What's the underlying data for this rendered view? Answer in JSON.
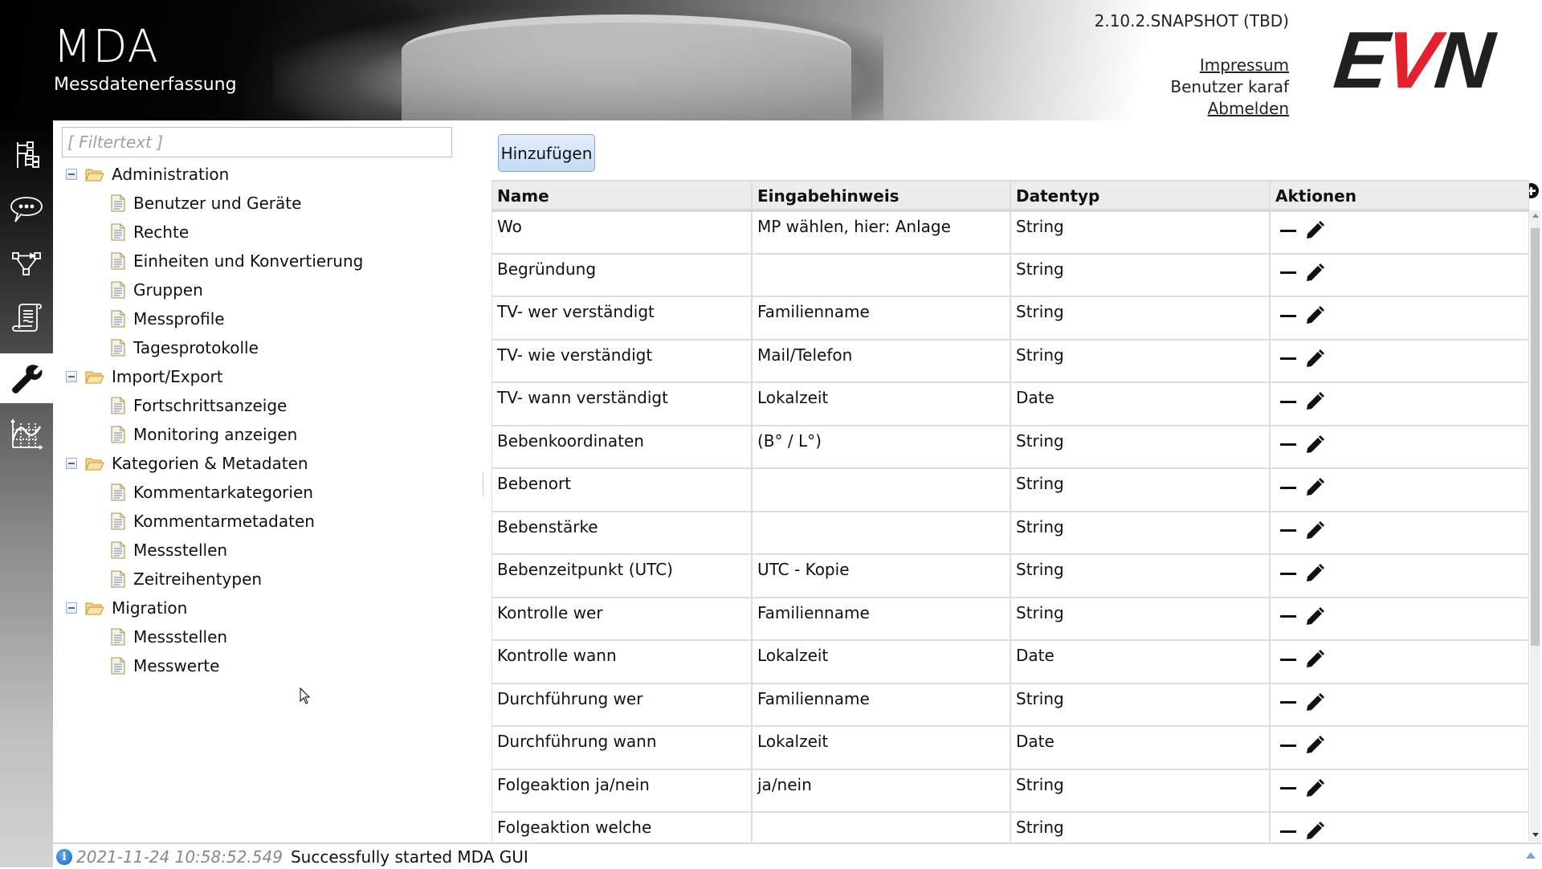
{
  "header": {
    "app_title": "MDA",
    "app_subtitle": "Messdatenerfassung",
    "version": "2.10.2.SNAPSHOT (TBD)",
    "impressum_link": "Impressum",
    "user_label": "Benutzer karaf",
    "logout_link": "Abmelden",
    "logo": {
      "e": "E",
      "v": "V",
      "n": "N"
    },
    "logo_colors": {
      "dark": "#231f20",
      "red": "#e3212e"
    }
  },
  "sidebar": {
    "items": [
      {
        "icon": "hierarchy-tree-icon",
        "active": false
      },
      {
        "icon": "speech-bubble-icon",
        "active": false
      },
      {
        "icon": "workflow-diagram-icon",
        "active": false
      },
      {
        "icon": "scroll-document-icon",
        "active": false
      },
      {
        "icon": "wrench-icon",
        "active": true
      },
      {
        "icon": "line-chart-icon",
        "active": false
      }
    ]
  },
  "tree": {
    "filter_placeholder": "[ Filtertext ]",
    "filter_value": "",
    "nodes": [
      {
        "label": "Administration",
        "type": "folder",
        "expanded": true,
        "children": [
          "Benutzer und Geräte",
          "Rechte",
          "Einheiten und Konvertierung",
          "Gruppen",
          "Messprofile",
          "Tagesprotokolle"
        ]
      },
      {
        "label": "Import/Export",
        "type": "folder",
        "expanded": true,
        "children": [
          "Fortschrittsanzeige",
          "Monitoring anzeigen"
        ]
      },
      {
        "label": "Kategorien & Metadaten",
        "type": "folder",
        "expanded": true,
        "children": [
          "Kommentarkategorien",
          "Kommentarmetadaten",
          "Messstellen",
          "Zeitreihentypen"
        ]
      },
      {
        "label": "Migration",
        "type": "folder",
        "expanded": true,
        "children": [
          "Messstellen",
          "Messwerte"
        ]
      }
    ]
  },
  "main": {
    "add_button": "Hinzufügen",
    "columns": [
      "Name",
      "Eingabehinweis",
      "Datentyp",
      "Aktionen"
    ],
    "rows": [
      {
        "name": "Wo",
        "hint": "MP wählen, hier: Anlage",
        "type": "String"
      },
      {
        "name": "Begründung",
        "hint": "",
        "type": "String"
      },
      {
        "name": "TV- wer verständigt",
        "hint": "Familienname",
        "type": "String"
      },
      {
        "name": "TV- wie verständigt",
        "hint": "Mail/Telefon",
        "type": "String"
      },
      {
        "name": "TV- wann verständigt",
        "hint": "Lokalzeit",
        "type": "Date"
      },
      {
        "name": "Bebenkoordinaten",
        "hint": "(B° / L°)",
        "type": "String"
      },
      {
        "name": "Bebenort",
        "hint": "",
        "type": "String"
      },
      {
        "name": "Bebenstärke",
        "hint": "",
        "type": "String"
      },
      {
        "name": "Bebenzeitpunkt (UTC)",
        "hint": "UTC - Kopie",
        "type": "String"
      },
      {
        "name": "Kontrolle wer",
        "hint": "Familienname",
        "type": "String"
      },
      {
        "name": "Kontrolle wann",
        "hint": "Lokalzeit",
        "type": "Date"
      },
      {
        "name": "Durchführung wer",
        "hint": "Familienname",
        "type": "String"
      },
      {
        "name": "Durchführung wann",
        "hint": "Lokalzeit",
        "type": "Date"
      },
      {
        "name": "Folgeaktion ja/nein",
        "hint": "ja/nein",
        "type": "String"
      },
      {
        "name": "Folgeaktion welche",
        "hint": "",
        "type": "String"
      }
    ],
    "row_actions": [
      "remove-icon",
      "edit-pencil-icon"
    ]
  },
  "status": {
    "icon": "info-icon",
    "timestamp": "2021-11-24 10:58:52.549",
    "message": "Successfully started MDA GUI"
  }
}
